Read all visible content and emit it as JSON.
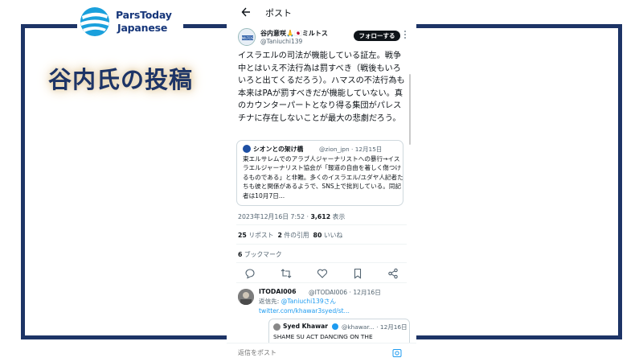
{
  "brand": {
    "line1": "ParsToday",
    "line2": "Japanese"
  },
  "headline": "谷内氏の投稿",
  "colors": {
    "frame": "#1d3466",
    "brand": "#16367a",
    "link": "#1d9bf0"
  },
  "topbar": {
    "back_icon": "arrow-left-icon",
    "title": "ポスト"
  },
  "post": {
    "author_name": "谷内意咲🙏🇯🇵ミルトス",
    "author_handle": "@Taniuchi139",
    "follow_label": "フォローする",
    "more_icon": "more-vertical-icon",
    "body": "イスラエルの司法が機能している証左。戦争中とはいえ不法行為は罰すべき（戦後もいろいろと出てくるだろう）。ハマスの不法行為も本来はPAが罰すべきだが機能していない。真のカウンターパートとなり得る集団がパレスチナに存在しないことが最大の悲劇だろう。",
    "quote": {
      "name": "シオンとの架け橋",
      "meta": "@zion_jpn · 12月15日",
      "body": "東エルサレムでのアラブ人ジャーナリストへの暴行→イスラエルジャーナリスト協会が「報道の自由を著しく傷つけるものである」と非難。多くのイスラエル/ユダヤ人記者たちも彼と関係があるようで、SNS上で批判している。同記者は10月7日..."
    },
    "timestamp": "2023年12月16日 7:52 · ",
    "views_count": "3,612",
    "views_label": " 表示",
    "reposts_count": "25",
    "reposts_label": " リポスト  ",
    "quotes_count": "2",
    "quotes_label": " 件の引用  ",
    "likes_count": "80",
    "likes_label": " いいね",
    "bookmarks_count": "6",
    "bookmarks_label": " ブックマーク",
    "actions": [
      "reply-icon",
      "repost-icon",
      "like-icon",
      "bookmark-icon",
      "share-icon"
    ]
  },
  "reply": {
    "name": "ITODAI006",
    "meta": "@ITODAI006 · 12月16日",
    "replyto_prefix": "返信先: ",
    "replyto_mention": "@Taniuchi139さん",
    "link": "twitter.com/khawar3syed/st...",
    "quote": {
      "name": "Syed Khawar",
      "meta": "@khawar... · 12月16日",
      "body": "SHAME SU ACT DANCING ON THE"
    }
  },
  "composer": {
    "placeholder": "返信をポスト",
    "icon": "image-icon"
  }
}
